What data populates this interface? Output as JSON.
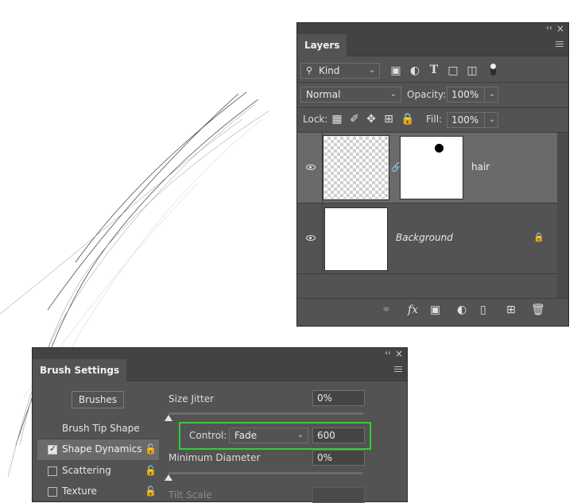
{
  "layers_panel": {
    "collapse": "‹‹",
    "close": "×",
    "tab_label": "Layers",
    "filter": {
      "value": "Kind"
    },
    "blend_mode": "Normal",
    "opacity_label": "Opacity:",
    "opacity_value": "100%",
    "lock_label": "Lock:",
    "fill_label": "Fill:",
    "fill_value": "100%",
    "layers": [
      {
        "name": "hair",
        "visible": true
      },
      {
        "name": "Background",
        "visible": true,
        "locked": true
      }
    ]
  },
  "brush_panel": {
    "collapse": "‹‹",
    "close": "×",
    "tab_label": "Brush Settings",
    "brushes_button": "Brushes",
    "list": [
      {
        "label": "Brush Tip Shape"
      },
      {
        "label": "Shape Dynamics",
        "checked": true
      },
      {
        "label": "Scattering",
        "checked": false
      },
      {
        "label": "Texture",
        "checked": false
      }
    ],
    "size_jitter_label": "Size Jitter",
    "size_jitter_value": "0%",
    "control_label": "Control:",
    "control_value": "Fade",
    "control_amount": "600",
    "min_diameter_label": "Minimum Diameter",
    "min_diameter_value": "0%",
    "tilt_scale_label": "Tilt Scale",
    "highlight_color": "#2fd12f"
  }
}
